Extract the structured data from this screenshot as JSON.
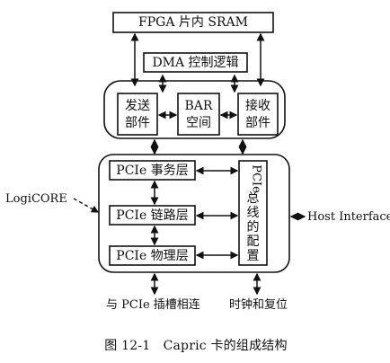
{
  "diagram": {
    "blocks": {
      "sram": "FPGA 片内 SRAM",
      "dma": "DMA 控制逻辑",
      "tx_line1": "发送",
      "tx_line2": "部件",
      "bar_line1": "BAR",
      "bar_line2": "空间",
      "rx_line1": "接收",
      "rx_line2": "部件",
      "transaction": "PCIe 事务层",
      "link": "PCIe 链路层",
      "physical": "PCIe 物理层",
      "config_line1": "PCIe",
      "config_line2": "总",
      "config_line3": "线",
      "config_line4": "的",
      "config_line5": "配",
      "config_line6": "置"
    },
    "labels": {
      "logicore": "LogiCORE",
      "host_interface": "Host Interface",
      "pcie_slot": "与 PCIe 插槽相连",
      "clock_reset": "时钟和复位"
    },
    "caption": "图 12-1　Capric 卡的组成结构"
  }
}
